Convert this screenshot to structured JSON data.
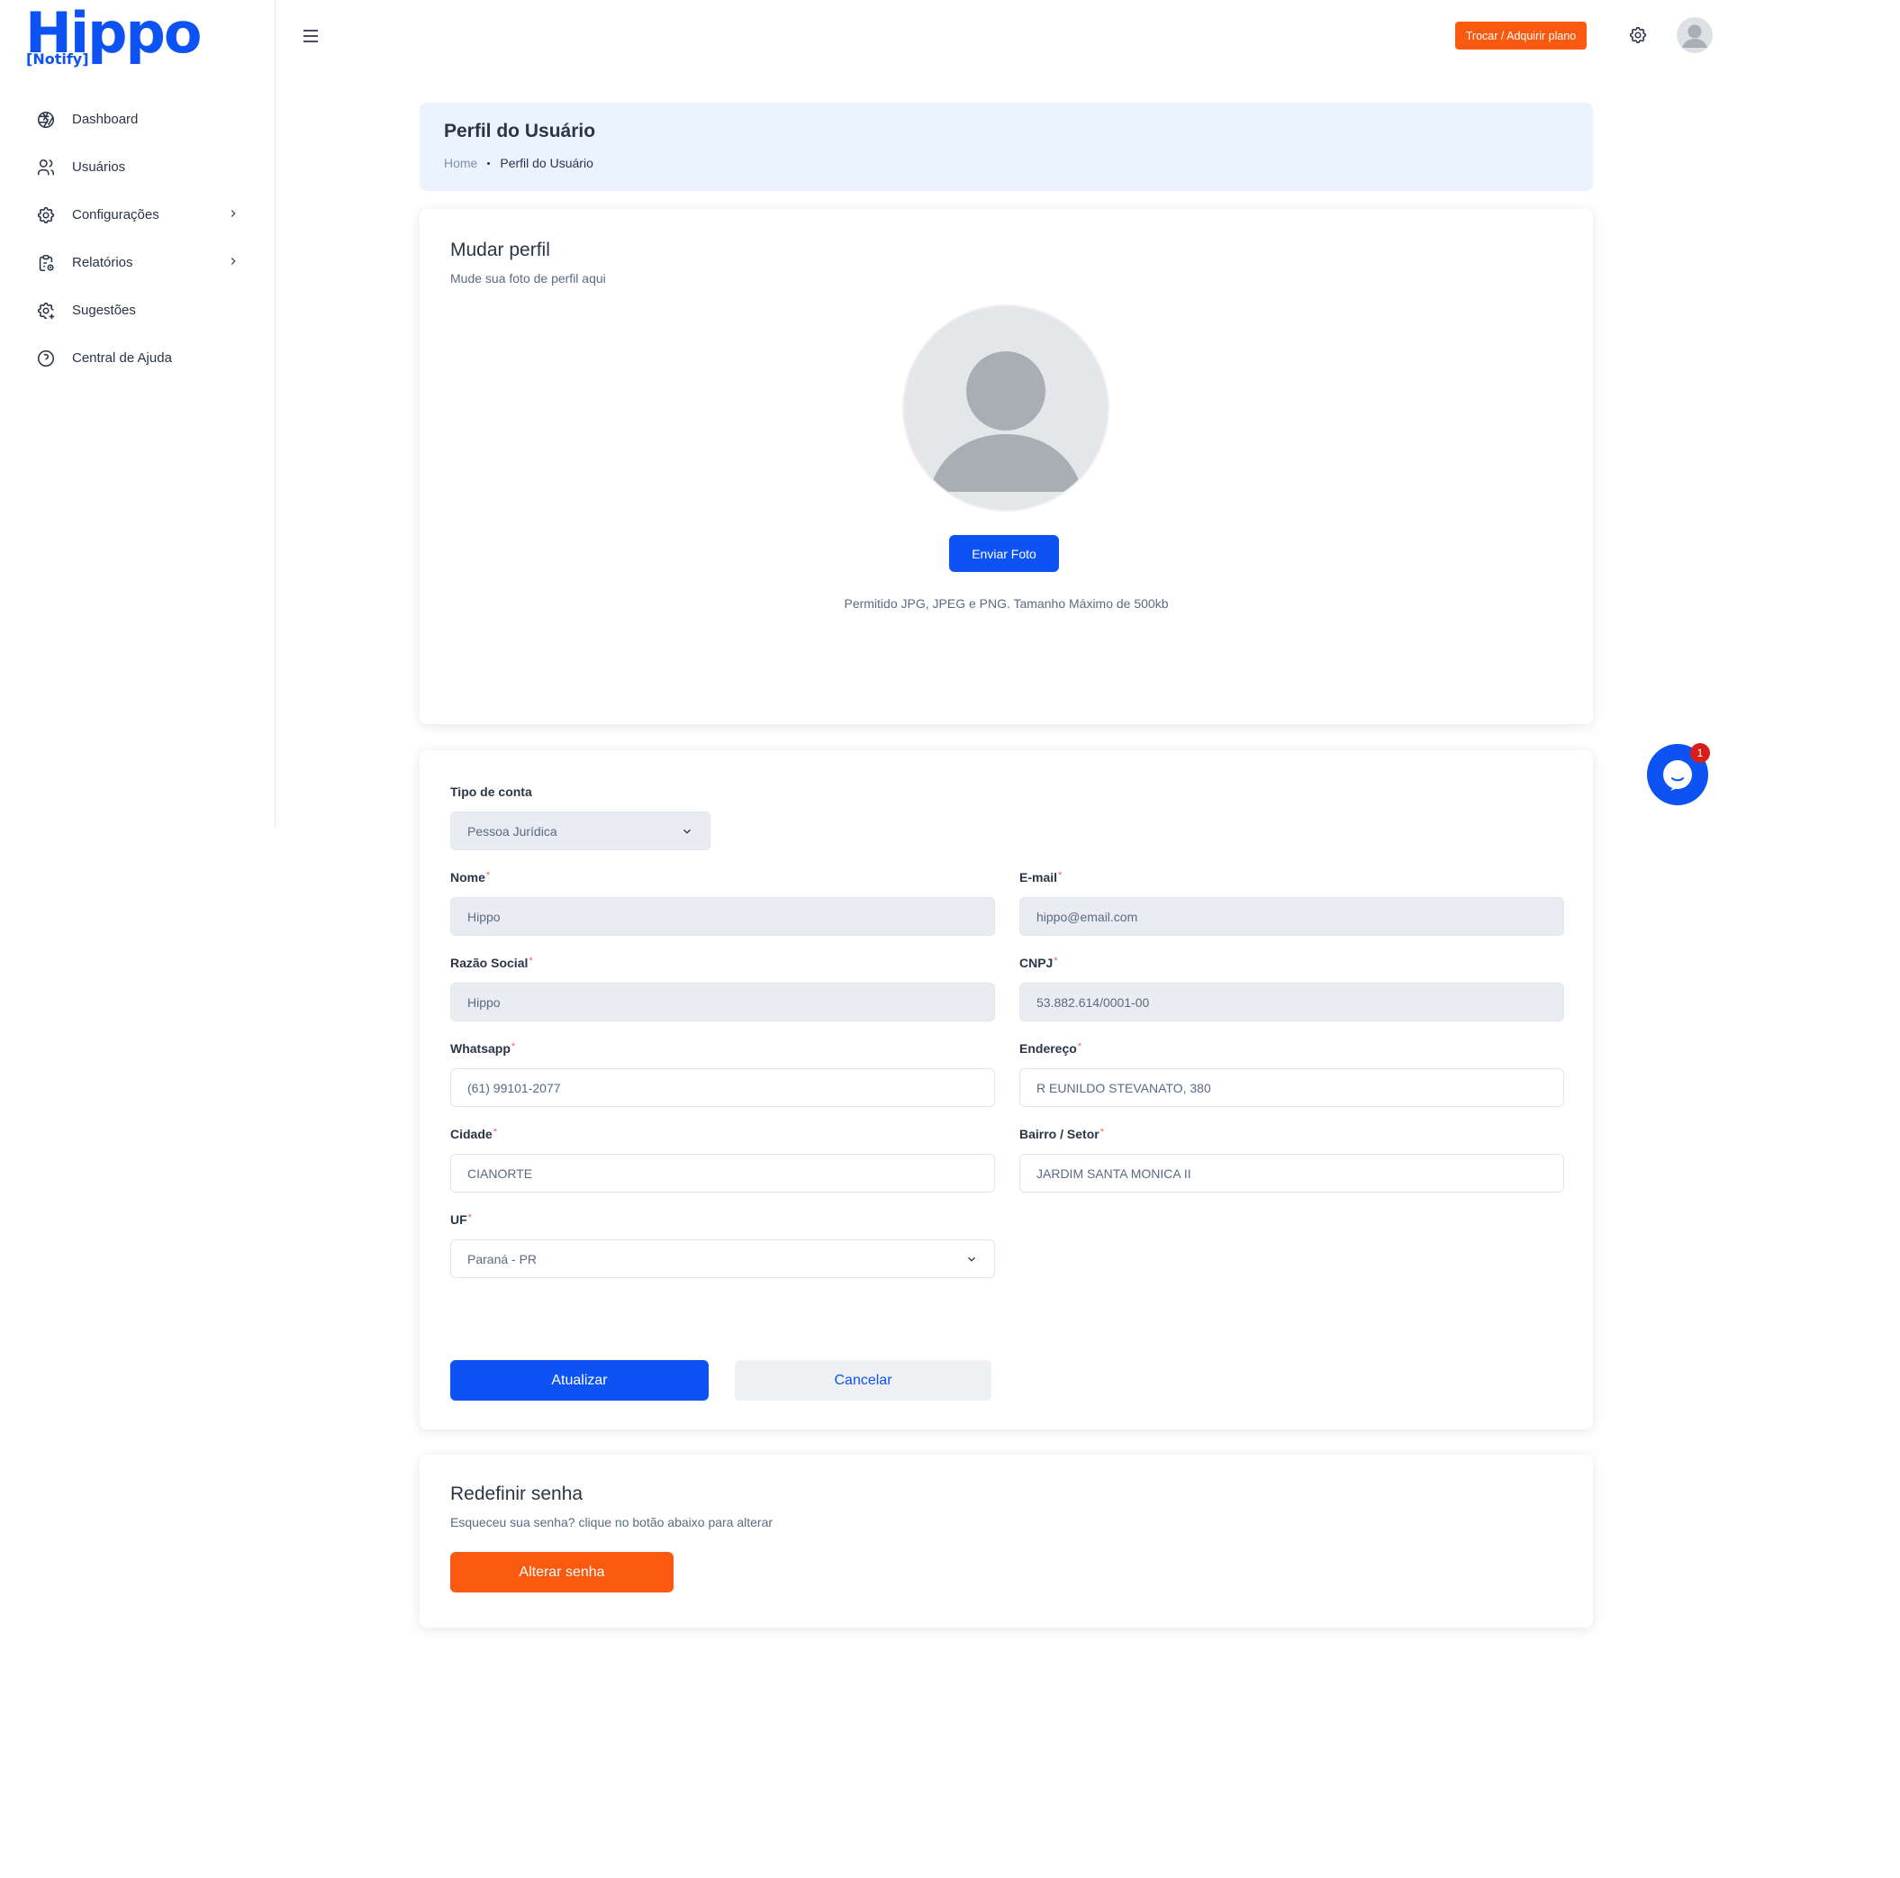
{
  "brand": {
    "logo_main": "Hippo",
    "logo_sub": "[Notify]"
  },
  "sidebar": {
    "items": [
      {
        "label": "Dashboard",
        "icon": "aperture-icon"
      },
      {
        "label": "Usuários",
        "icon": "users-icon"
      },
      {
        "label": "Configurações",
        "icon": "gear-icon",
        "has_submenu": true
      },
      {
        "label": "Relatórios",
        "icon": "clipboard-icon",
        "has_submenu": true
      },
      {
        "label": "Sugestões",
        "icon": "gear-plus-icon"
      },
      {
        "label": "Central de Ajuda",
        "icon": "help-circle-icon"
      }
    ]
  },
  "topbar": {
    "plan_button": "Trocar / Adquirir plano"
  },
  "page_header": {
    "title": "Perfil do Usuário",
    "breadcrumb_home": "Home",
    "breadcrumb_current": "Perfil do Usuário"
  },
  "profile_card": {
    "title": "Mudar perfil",
    "subtitle": "Mude sua foto de perfil aqui",
    "upload_button": "Enviar Foto",
    "hint": "Permitido JPG, JPEG e PNG. Tamanho Máximo de 500kb"
  },
  "form": {
    "account_type_label": "Tipo de conta",
    "account_type_value": "Pessoa Jurídica",
    "nome_label": "Nome",
    "nome_value": "Hippo",
    "email_label": "E-mail",
    "email_value": "hippo@email.com",
    "razao_label": "Razão Social",
    "razao_value": "Hippo",
    "cnpj_label": "CNPJ",
    "cnpj_value": "53.882.614/0001-00",
    "whatsapp_label": "Whatsapp",
    "whatsapp_value": "(61) 99101-2077",
    "endereco_label": "Endereço",
    "endereco_value": "R EUNILDO STEVANATO, 380",
    "cidade_label": "Cidade",
    "cidade_value": "CIANORTE",
    "bairro_label": "Bairro / Setor",
    "bairro_value": "JARDIM SANTA MONICA II",
    "uf_label": "UF",
    "uf_value": "Paraná - PR",
    "required_mark": "*",
    "submit_button": "Atualizar",
    "cancel_button": "Cancelar"
  },
  "password_card": {
    "title": "Redefinir senha",
    "subtitle": "Esqueceu sua senha? clique no botão abaixo para alterar",
    "button": "Alterar senha"
  },
  "chat": {
    "badge": "1"
  },
  "colors": {
    "primary": "#0d52f2",
    "accent": "#fa5a0f",
    "header_bg": "#ebf3fe",
    "badge": "#d91e18"
  }
}
